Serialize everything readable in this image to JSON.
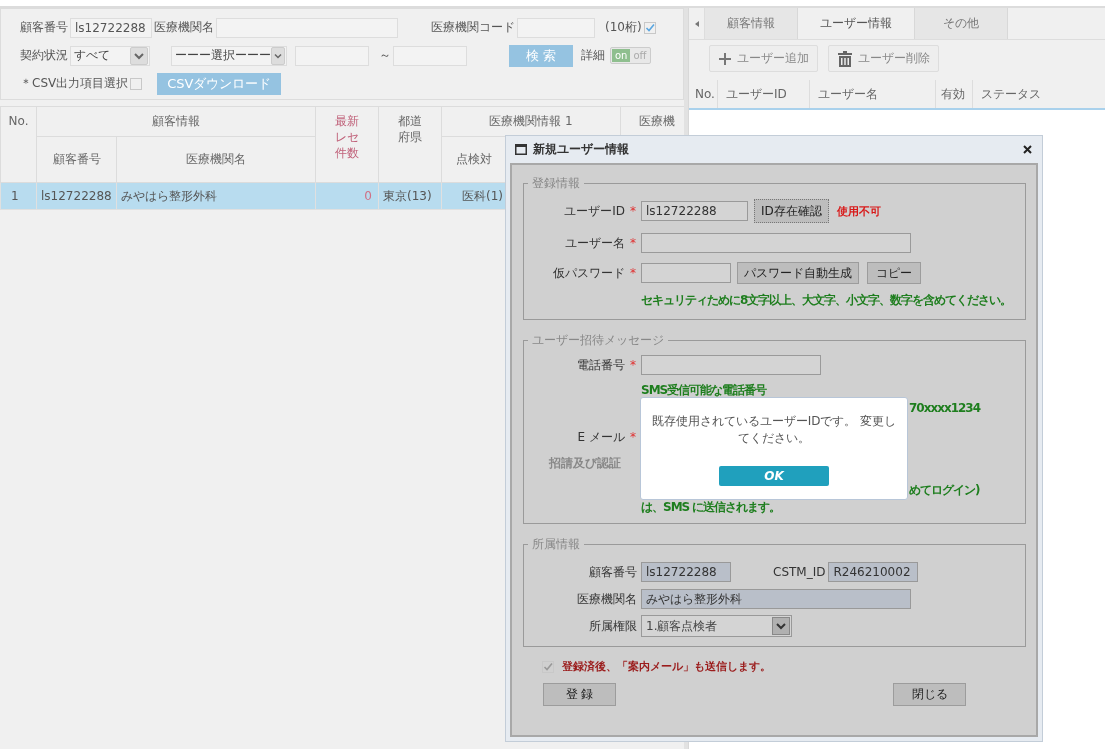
{
  "search": {
    "customer_no": {
      "label": "顧客番号",
      "value": "ls12722288"
    },
    "facility_name": {
      "label": "医療機関名"
    },
    "facility_code": {
      "label": "医療機関コード",
      "note": "(10桁)",
      "checked": true
    },
    "contract": {
      "label": "契約状況",
      "value": "すべて"
    },
    "filter_select": {
      "value": "ーーー選択ーーー"
    },
    "range_separator": "～",
    "search_button": "検 索",
    "detail": {
      "label": "詳細",
      "on_text": "on",
      "off_text": "off",
      "on": true
    },
    "csv": {
      "label": "＊CSV出力項目選択",
      "checked": false,
      "button": "CSVダウンロード"
    }
  },
  "table": {
    "header_rows": [
      [
        {
          "label": "No.",
          "rowspan": 2
        },
        {
          "label": "顧客情報",
          "colspan": 2
        },
        {
          "label": "最新レセ件数",
          "rowspan": 2,
          "kind": "accent"
        },
        {
          "label": "都道府県",
          "rowspan": 2
        },
        {
          "label": "医療機関情報 1"
        },
        {
          "label": "医療機",
          "rowspan": 2
        }
      ],
      [
        {
          "label": "顧客番号"
        },
        {
          "label": "医療機関名"
        },
        {
          "label": "点検対"
        }
      ]
    ],
    "rows": [
      {
        "selected": true,
        "cells": [
          "1",
          "ls12722288",
          "みやはら整形外科",
          "0",
          "東京(13)",
          "医科(1)"
        ]
      }
    ]
  },
  "tabs": [
    {
      "label": "顧客情報",
      "selected": false
    },
    {
      "label": "ユーザー情報",
      "selected": true
    },
    {
      "label": "その他",
      "selected": false
    }
  ],
  "toolbar": [
    {
      "label": "ユーザー追加",
      "kind": "add"
    },
    {
      "label": "ユーザー削除",
      "kind": "delete"
    }
  ],
  "user_table": {
    "columns": [
      "No.",
      "ユーザーID",
      "ユーザー名",
      "有効",
      "ステータス"
    ]
  },
  "dialog": {
    "title": "新規ユーザー情報",
    "registration": {
      "legend": "登録情報",
      "user_id": {
        "label": "ユーザーID",
        "required_mark": "*",
        "value": "ls12722288",
        "button": "ID存在確認",
        "result": "使用不可"
      },
      "user_name": {
        "label": "ユーザー名",
        "required_mark": "*"
      },
      "temp_password": {
        "label": "仮パスワード",
        "required_mark": "*",
        "buttons": [
          "パスワード自動生成",
          "コピー"
        ]
      },
      "hint": "セキュリティために8文字以上、大文字、小文字、数字を含めてください。"
    },
    "invitation": {
      "legend": "ユーザー招待メッセージ",
      "phone": {
        "label": "電話番号",
        "required_mark": "*"
      },
      "phone_hints": [
        {
          "kind": "line",
          "text": "SMS受信可能な電話番号"
        },
        {
          "kind": "tail",
          "text": "70xxxx1234"
        }
      ],
      "email": {
        "label": "E メール",
        "required_mark": "*"
      },
      "auth": {
        "label": "招請及び認証",
        "disabled": true
      },
      "notes": [
        {
          "kind": "tail",
          "text": "めてログイン)"
        },
        {
          "kind": "line",
          "text": "は、SMS に送信されます。"
        }
      ]
    },
    "affiliation": {
      "legend": "所属情報",
      "customer_no": {
        "label": "顧客番号",
        "value": "ls12722288"
      },
      "cstm_id": {
        "label": "CSTM_ID",
        "value": "R246210002"
      },
      "facility_name": {
        "label": "医療機関名",
        "value": "みやはら整形外科"
      },
      "role": {
        "label": "所属権限",
        "value": "1.顧客点検者"
      }
    },
    "send_mail": {
      "checked": true,
      "label": "登録済後、「案内メール」も送信します。"
    },
    "buttons": [
      "登 録",
      "閉じる"
    ]
  },
  "alert": {
    "message": "既存使用されているユーザーIDです。 変更してください。",
    "button": "OK"
  }
}
